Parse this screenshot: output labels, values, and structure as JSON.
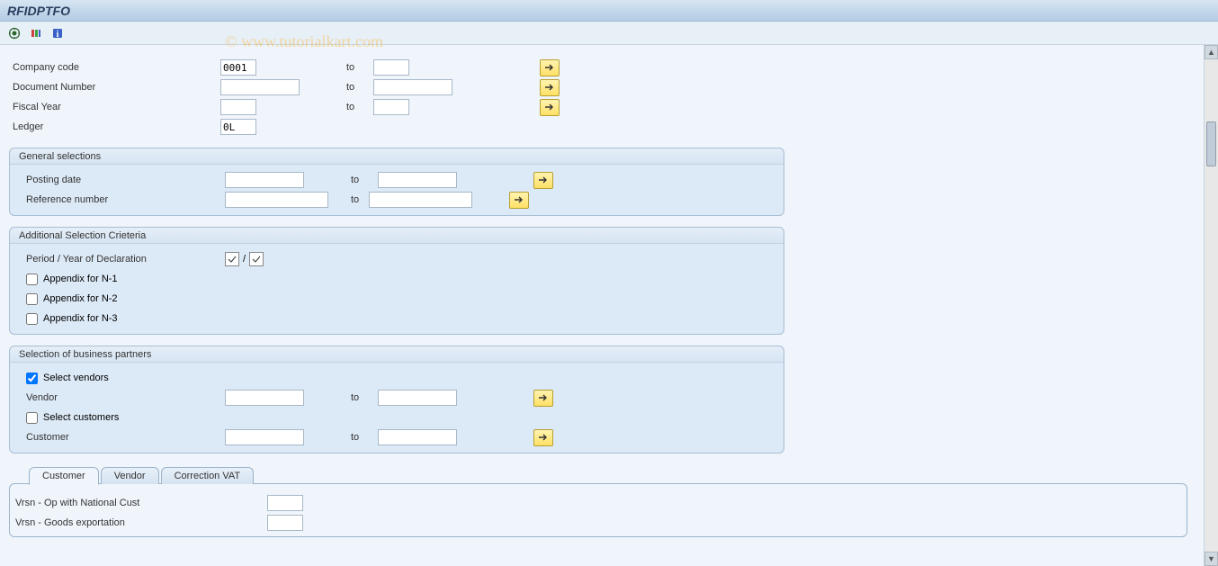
{
  "title": "RFIDPTFO",
  "watermark": "© www.tutorialkart.com",
  "topRows": {
    "companyCode": {
      "label": "Company code",
      "from": "0001",
      "to": ""
    },
    "documentNumber": {
      "label": "Document Number",
      "from": "",
      "to": ""
    },
    "fiscalYear": {
      "label": "Fiscal Year",
      "from": "",
      "to": ""
    },
    "ledger": {
      "label": "Ledger",
      "value": "0L"
    }
  },
  "toLabel": "to",
  "groups": {
    "general": {
      "title": "General selections",
      "postingDate": {
        "label": "Posting date",
        "from": "",
        "to": ""
      },
      "referenceNumber": {
        "label": "Reference number",
        "from": "",
        "to": ""
      }
    },
    "additional": {
      "title": "Additional Selection Crieteria",
      "periodYear": {
        "label": "Period / Year of Declaration"
      },
      "appN1": {
        "label": "Appendix for N-1",
        "checked": false
      },
      "appN2": {
        "label": "Appendix for N-2",
        "checked": false
      },
      "appN3": {
        "label": "Appendix for N-3",
        "checked": false
      }
    },
    "partners": {
      "title": "Selection of business partners",
      "selectVendors": {
        "label": "Select vendors",
        "checked": true
      },
      "vendor": {
        "label": "Vendor",
        "from": "",
        "to": ""
      },
      "selectCustomers": {
        "label": "Select customers",
        "checked": false
      },
      "customer": {
        "label": "Customer",
        "from": "",
        "to": ""
      }
    }
  },
  "tabs": {
    "customer": "Customer",
    "vendor": "Vendor",
    "correctionVat": "Correction VAT",
    "rows": {
      "row1": {
        "label": "Vrsn - Op with National Cust",
        "value": ""
      },
      "row2": {
        "label": "Vrsn - Goods exportation",
        "value": ""
      }
    }
  }
}
